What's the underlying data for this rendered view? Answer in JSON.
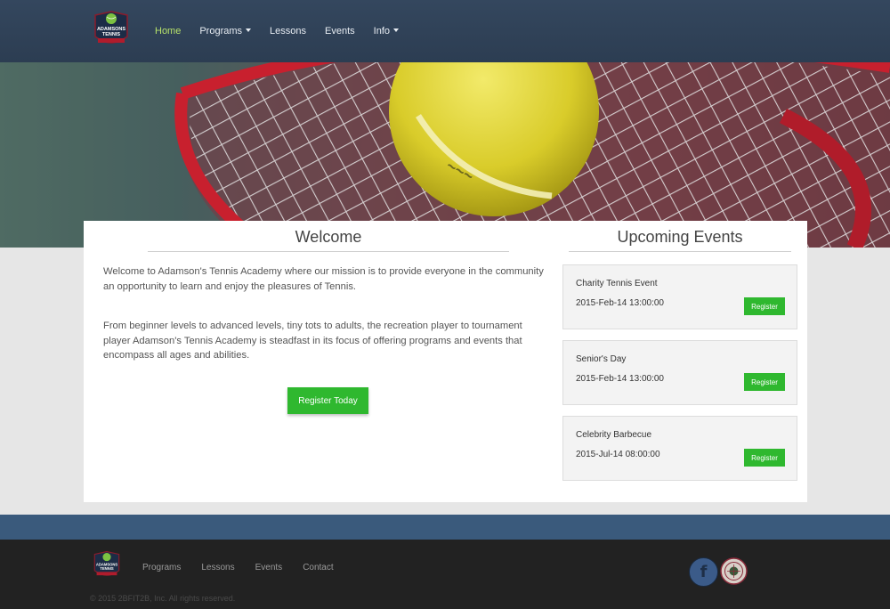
{
  "navbar": {
    "logo_text": [
      "ADAMSONS",
      "TENNIS"
    ],
    "items": [
      {
        "label": "Home",
        "active": true,
        "dropdown": false
      },
      {
        "label": "Programs",
        "active": false,
        "dropdown": true
      },
      {
        "label": "Lessons",
        "active": false,
        "dropdown": false
      },
      {
        "label": "Events",
        "active": false,
        "dropdown": false
      },
      {
        "label": "Info",
        "active": false,
        "dropdown": true
      }
    ]
  },
  "welcome": {
    "title": "Welcome",
    "paragraph_1": "Welcome to Adamson's Tennis Academy where our mission is to provide everyone in the community an opportunity to learn and enjoy the pleasures of Tennis.",
    "paragraph_2": "From beginner levels to advanced levels, tiny tots to adults, the recreation player to tournament player Adamson's Tennis Academy is steadfast in its focus of offering programs and events that encompass all ages and abilities.",
    "cta_label": "Register Today"
  },
  "events": {
    "title": "Upcoming Events",
    "items": [
      {
        "name": "Charity Tennis Event",
        "date": "2015-Feb-14 13:00:00",
        "button": "Register"
      },
      {
        "name": "Senior's Day",
        "date": "2015-Feb-14 13:00:00",
        "button": "Register"
      },
      {
        "name": "Celebrity Barbecue",
        "date": "2015-Jul-14 08:00:00",
        "button": "Register"
      }
    ]
  },
  "footer": {
    "links": [
      "Programs",
      "Lessons",
      "Events",
      "Contact"
    ],
    "copyright": "© 2015 2BFIT2B, Inc. All rights reserved.",
    "social": [
      "facebook-icon",
      "wimbledon-icon"
    ]
  },
  "colors": {
    "navbar": "#2c3d52",
    "nav_active": "#b7e26a",
    "accent_green": "#2fb82f",
    "band_blue": "#3a5a7c",
    "footer_bg": "#222222"
  }
}
